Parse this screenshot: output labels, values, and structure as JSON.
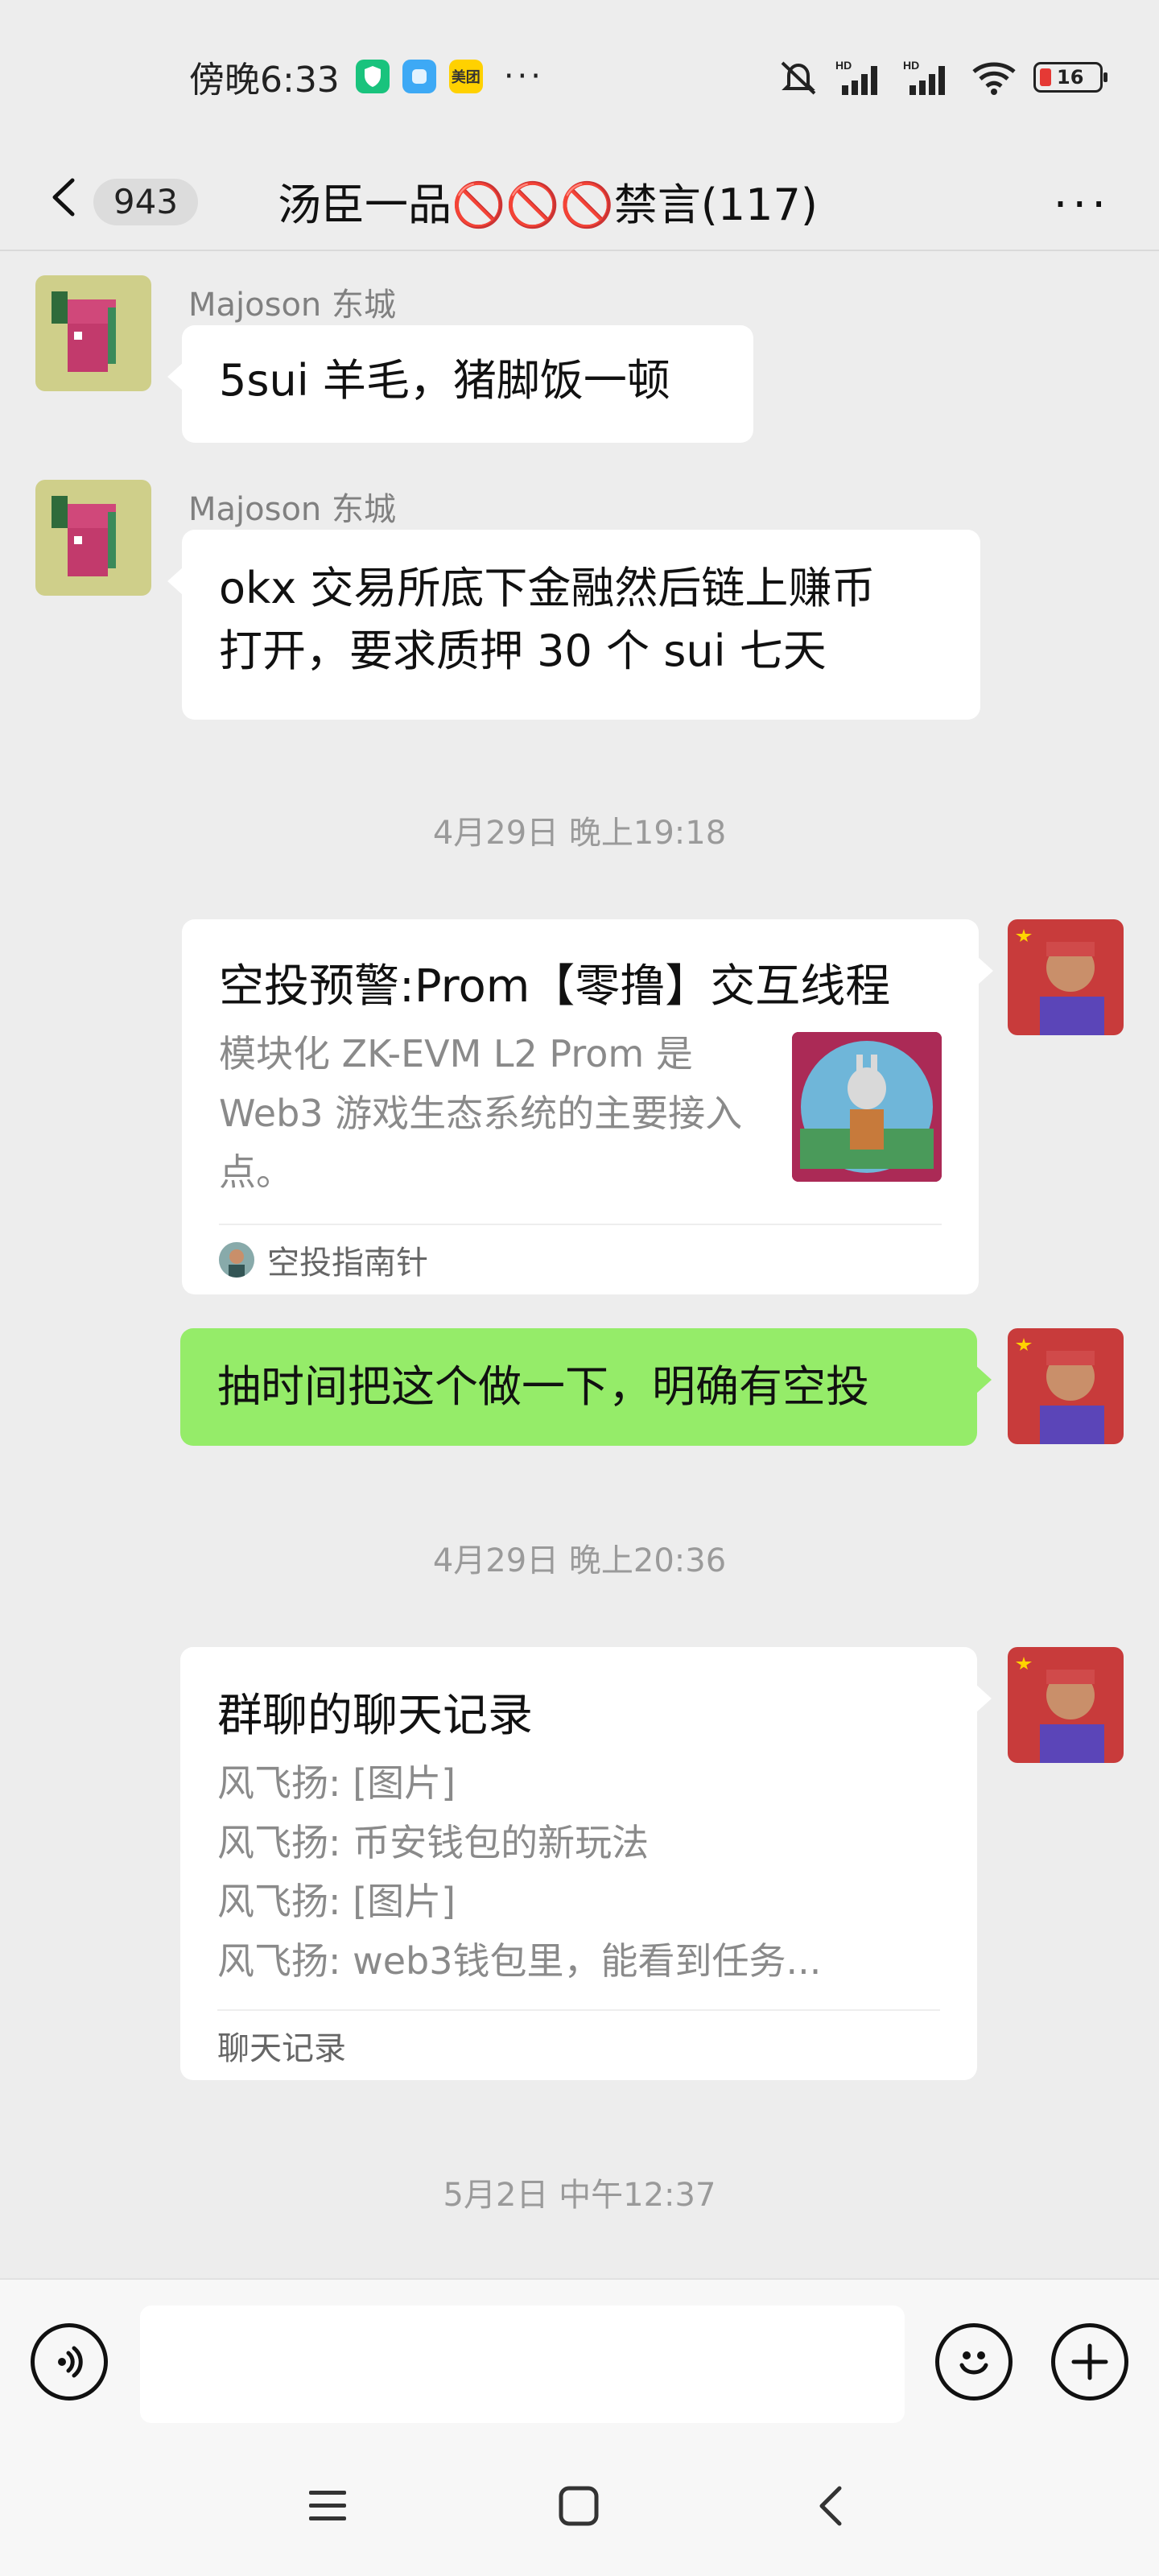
{
  "status_bar": {
    "time": "傍晚6:33",
    "app_badge": "美团",
    "more_dots": "···",
    "battery_level": "16"
  },
  "header": {
    "back_count": "943",
    "title": "汤臣一品🚫🚫🚫禁言(117)",
    "more": "···"
  },
  "messages": [
    {
      "sender": "Majoson 东城",
      "text": "5sui 羊毛，猪脚饭一顿"
    },
    {
      "sender": "Majoson 东城",
      "text_lines": [
        "okx 交易所底下金融然后链上赚币",
        "打开，要求质押 30 个 sui 七天"
      ]
    }
  ],
  "timestamps": [
    "4月29日 晚上19:18",
    "4月29日 晚上20:36",
    "5月2日 中午12:37"
  ],
  "share_card": {
    "title": "空投预警:Prom【零撸】交互线程",
    "description": "模块化 ZK-EVM L2  Prom 是 Web3 游戏生态系统的主要接入点。",
    "source": "空投指南针"
  },
  "my_message": "抽时间把这个做一下，明确有空投",
  "chat_record": {
    "title": "群聊的聊天记录",
    "lines": [
      "风飞扬: [图片]",
      "风飞扬: 币安钱包的新玩法",
      "风飞扬: [图片]",
      "风飞扬: web3钱包里，能看到任务..."
    ],
    "footer": "聊天记录"
  },
  "colors": {
    "background": "#ededed",
    "bubble_white": "#ffffff",
    "bubble_green": "#95ec69",
    "secondary_text": "#8a8a8a"
  },
  "icons": {
    "back": "chevron-left-icon",
    "more": "more-icon",
    "voice": "voice-icon",
    "emoji": "emoji-icon",
    "plus": "plus-icon"
  }
}
